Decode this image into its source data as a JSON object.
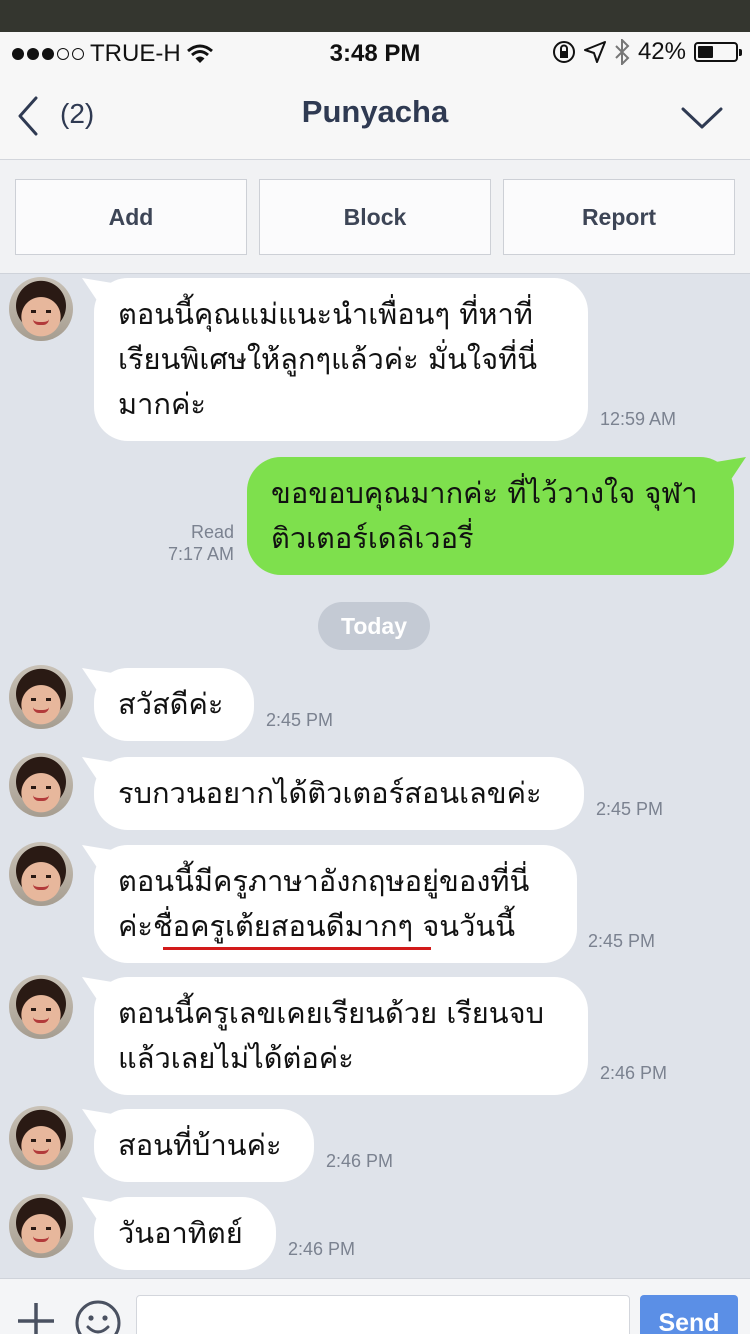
{
  "status_bar": {
    "carrier": "TRUE-H",
    "time": "3:48 PM",
    "battery": "42%",
    "battery_level": 0.42,
    "signal_bars": 3,
    "icons": [
      "wifi-icon",
      "lock-rotation-icon",
      "location-icon",
      "bluetooth-icon",
      "battery-icon"
    ]
  },
  "header": {
    "back_count": "(2)",
    "title": "Punyacha",
    "icons": [
      "back-chevron-icon",
      "chevron-down-icon"
    ]
  },
  "actions": [
    {
      "label": "Add"
    },
    {
      "label": "Block"
    },
    {
      "label": "Report"
    }
  ],
  "messages": [
    {
      "text": "ตอนนี้คุณแม่แนะนำเพื่อนๆ ที่หาที่\nเรียนพิเศษให้ลูกๆแล้วค่ะ มั่นใจที่นี่\nมากค่ะ",
      "time": "12:59 AM",
      "direction": "in"
    },
    {
      "text": "ขอขอบคุณมากค่ะ ที่ไว้วางใจ จุฬา\nติวเตอร์เดลิเวอรี่",
      "read": "Read",
      "time": "7:17 AM",
      "direction": "out"
    },
    {
      "text": "สวัสดีค่ะ",
      "time": "2:45 PM",
      "direction": "in"
    },
    {
      "text": "รบกวนอยากได้ติวเตอร์สอนเลขค่ะ",
      "time": "2:45 PM",
      "direction": "in"
    },
    {
      "text": "ตอนนี้มีครูภาษาอังกฤษอยู่ของที่นี่\nค่ะชื่อครูเต้ยสอนดีมากๆ จนวันนี้",
      "time": "2:45 PM",
      "direction": "in"
    },
    {
      "text": "ตอนนี้ครูเลขเคยเรียนด้วย เรียนจบ\nแล้วเลยไม่ได้ต่อค่ะ",
      "time": "2:46 PM",
      "direction": "in"
    },
    {
      "text": "สอนที่บ้านค่ะ",
      "time": "2:46 PM",
      "direction": "in"
    },
    {
      "text": "วันอาทิตย์",
      "time": "2:46 PM",
      "direction": "in"
    }
  ],
  "date_divider": "Today",
  "input_bar": {
    "placeholder": "",
    "send_label": "Send",
    "icons": [
      "plus-icon",
      "emoji-icon"
    ]
  },
  "colors": {
    "outgoing_bubble": "#7ee04d",
    "incoming_bubble": "#ffffff",
    "chat_background": "#dfe3ea",
    "send_button": "#5b8fe6",
    "annotation_underline": "#d21a1a"
  }
}
